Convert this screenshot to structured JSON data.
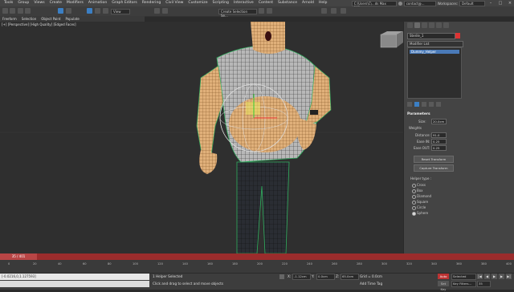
{
  "menu": [
    "Tools",
    "Group",
    "Views",
    "Create",
    "Modifiers",
    "Animation",
    "Graph Editors",
    "Rendering",
    "Civil View",
    "Customize",
    "Scripting",
    "Interactive",
    "Content",
    "Substance",
    "Arnold",
    "Help"
  ],
  "account": {
    "user": "contact@..."
  },
  "workspace": {
    "label": "Workspaces:",
    "value": "Default"
  },
  "project_path": "C:\\Users\\C\\...ds Max 202...",
  "toolbar": {
    "view_dropdown": "View",
    "selection_set": "Create Selection Se..."
  },
  "ribbon": [
    "Freeform",
    "Selection",
    "Object Paint",
    "Populate"
  ],
  "ribbon_sub": [
    "Trans",
    "ation",
    "Refine",
    "Edit"
  ],
  "viewport": {
    "label": "[+] [Perspective] [High Quality] [Edged Faces]"
  },
  "command_panel": {
    "object_name": "Sterile_1",
    "object_color": "#d33333",
    "modifier_list": "Modifier List",
    "stack_entry": "Dummy_Helper",
    "rollout": "Parameters",
    "size_label": "Size:",
    "size_value": "20.0cm",
    "weights_label": "Weights",
    "distance_label": "Distance:",
    "distance_value": "91.0",
    "ease_in_label": "Ease IN:",
    "ease_in_value": "0.25",
    "ease_out_label": "Ease OUT:",
    "ease_out_value": "0.25",
    "reset_btn": "Reset Transform",
    "capture_btn": "Capture Transform",
    "helper_type_label": "Helper type :",
    "helper_types": [
      "Cross",
      "Box",
      "Diamond",
      "Square",
      "Circle",
      "Sphere"
    ],
    "helper_selected": "Sphere"
  },
  "time": {
    "slider": "35 / 401",
    "ticks": [
      "0",
      "20",
      "40",
      "60",
      "80",
      "100",
      "120",
      "140",
      "160",
      "180",
      "200",
      "220",
      "240",
      "260",
      "280",
      "300",
      "320",
      "340",
      "360",
      "380",
      "400"
    ]
  },
  "status": {
    "maxscript": "[-0.0216,0,1.127593]",
    "selection": "1 Helper Selected",
    "prompt": "Click and drag to select and move objects",
    "x_label": "X:",
    "x_value": "-1.12cm",
    "y_label": "Y:",
    "y_value": "0.0cm",
    "z_label": "Z:",
    "z_value": "65.0cm",
    "grid": "Grid = 0.0cm",
    "add_time_tag": "Add Time Tag",
    "auto_key": "Auto Key",
    "set_key": "Set Key",
    "key_filters": "Key Filters...",
    "selected_dropdown": "Selected",
    "frame": "35"
  },
  "colors": {
    "timeline": "#9b2c2c",
    "selected_entry": "#4a7ab8",
    "auto_key": "#bb3333"
  }
}
